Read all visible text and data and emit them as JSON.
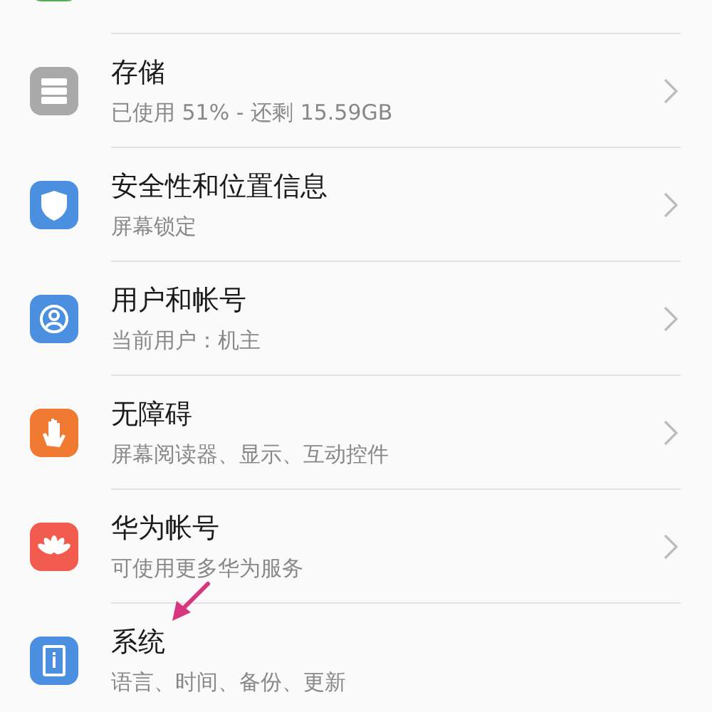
{
  "settings": [
    {
      "kind": "sound",
      "color": "#4cb050",
      "chevron": false
    },
    {
      "kind": "storage",
      "color": "#a9a9a9",
      "title": "存储",
      "subtitle": "已使用 51% - 还剩 15.59GB",
      "chevron": true
    },
    {
      "kind": "shield",
      "color": "#4a8fe0",
      "title": "安全性和位置信息",
      "subtitle": "屏幕锁定",
      "chevron": true
    },
    {
      "kind": "user",
      "color": "#4a8fe0",
      "title": "用户和帐号",
      "subtitle": "当前用户：机主",
      "chevron": true
    },
    {
      "kind": "hand",
      "color": "#f07a32",
      "title": "无障碍",
      "subtitle": "屏幕阅读器、显示、互动控件",
      "chevron": true
    },
    {
      "kind": "flower",
      "color": "#f25c4f",
      "title": "华为帐号",
      "subtitle": "可使用更多华为服务",
      "chevron": true
    },
    {
      "kind": "system",
      "color": "#4a8fe0",
      "title": "系统",
      "subtitle": "语言、时间、备份、更新",
      "chevron": false
    }
  ],
  "annotation": {
    "kind": "arrow",
    "color": "#d6377e"
  }
}
